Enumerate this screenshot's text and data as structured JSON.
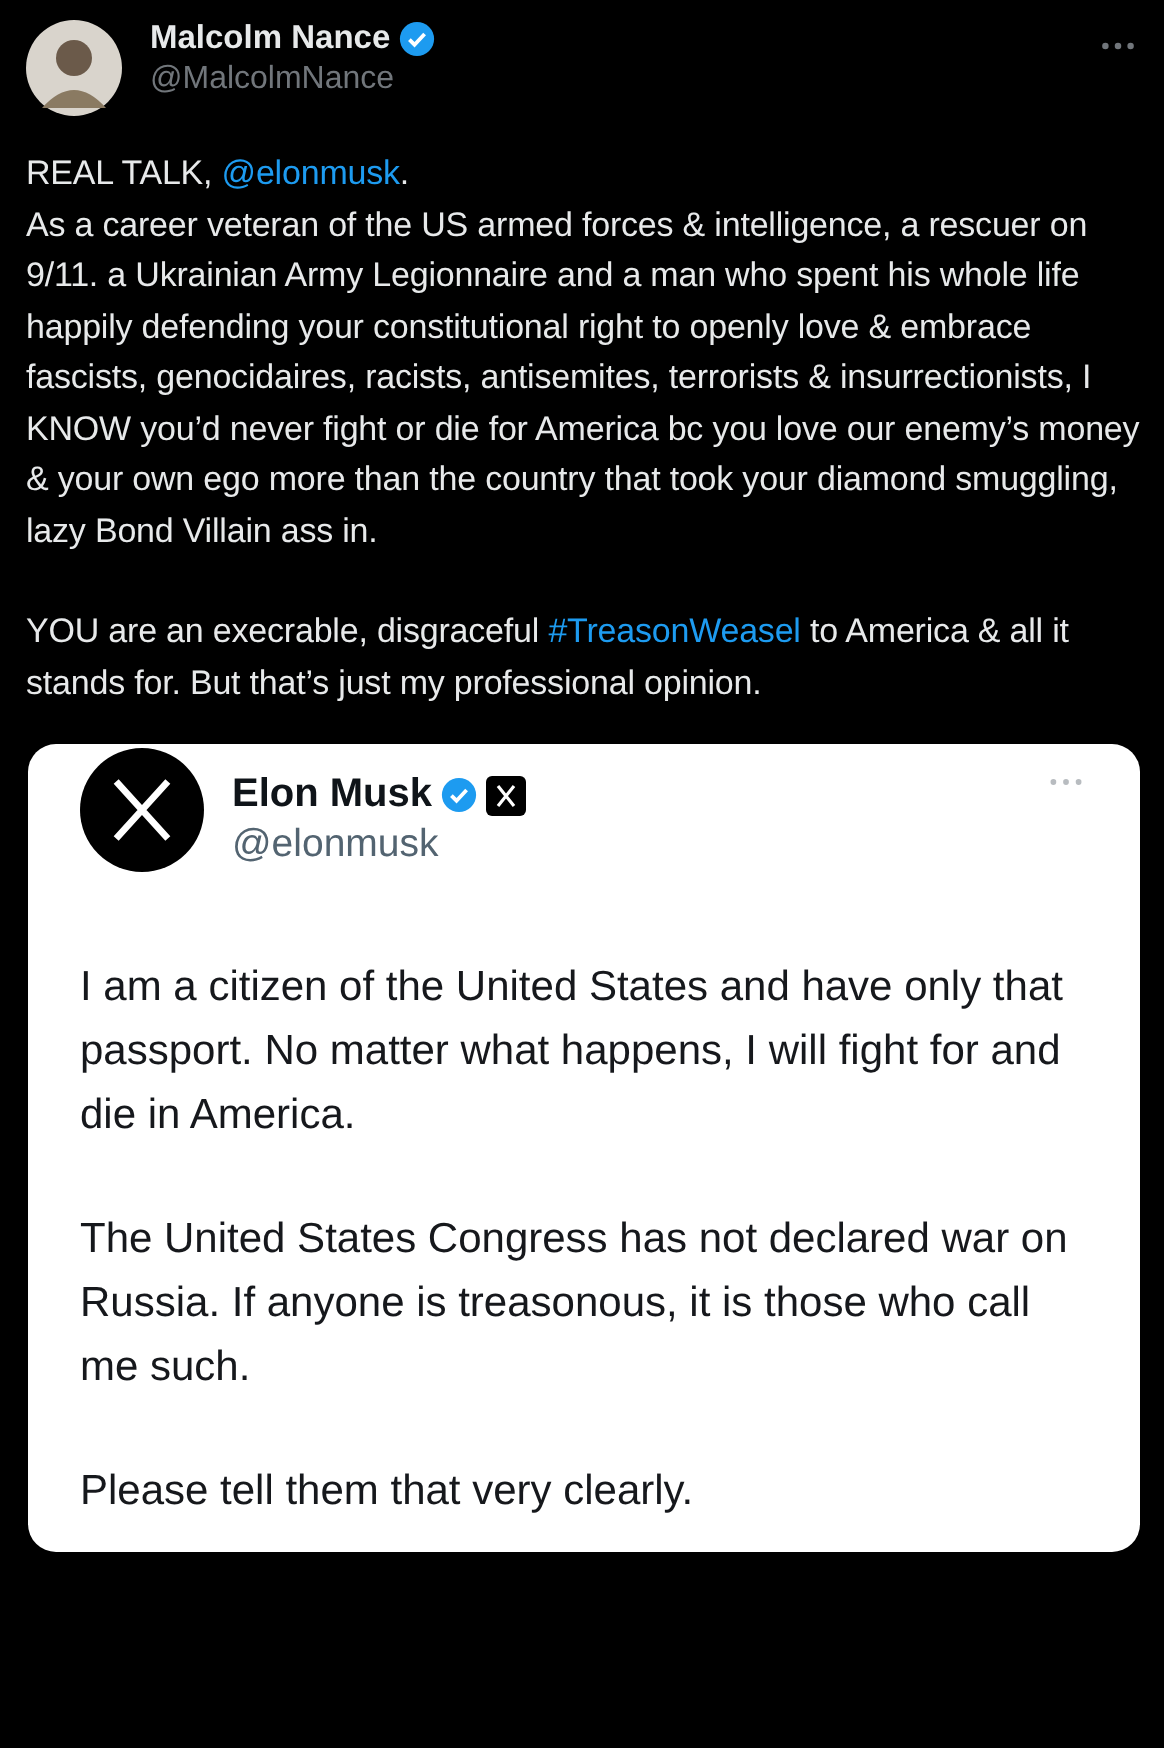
{
  "author": {
    "name": "Malcolm Nance",
    "handle": "@MalcolmNance",
    "verified": true
  },
  "paragraphs": [
    [
      [
        {
          "kind": "plain",
          "text": "REAL TALK, "
        },
        {
          "kind": "link",
          "text": "@elonmusk"
        },
        {
          "kind": "plain",
          "text": "."
        }
      ],
      [
        {
          "kind": "plain",
          "text": "As a career veteran of the US armed forces & intelligence, a rescuer on 9/11. a Ukrainian Army Legionnaire and a man who spent his whole life happily defending your constitutional right to openly love & embrace fascists, genocidaires, racists, antisemites, terrorists & insurrectionists, I KNOW you’d never fight or die for America bc you love our enemy’s money & your own ego more than the country that took your diamond smuggling, lazy Bond Villain ass in."
        }
      ]
    ],
    [
      [
        {
          "kind": "plain",
          "text": "YOU are an execrable, disgraceful "
        },
        {
          "kind": "link",
          "text": "#TreasonWeasel"
        },
        {
          "kind": "plain",
          "text": " to America & all it stands for. But that’s just my professional opinion."
        }
      ]
    ]
  ],
  "embedded": {
    "author": {
      "name": "Elon Musk",
      "handle": "@elonmusk",
      "verified": true
    },
    "paragraphs": [
      "I am a citizen of the United States and have only that passport. No matter what happens, I will fight for and die in America.",
      "The United States Congress has not declared war on Russia. If anyone is treasonous, it is those who call me such.",
      "Please tell them that very clearly."
    ]
  }
}
